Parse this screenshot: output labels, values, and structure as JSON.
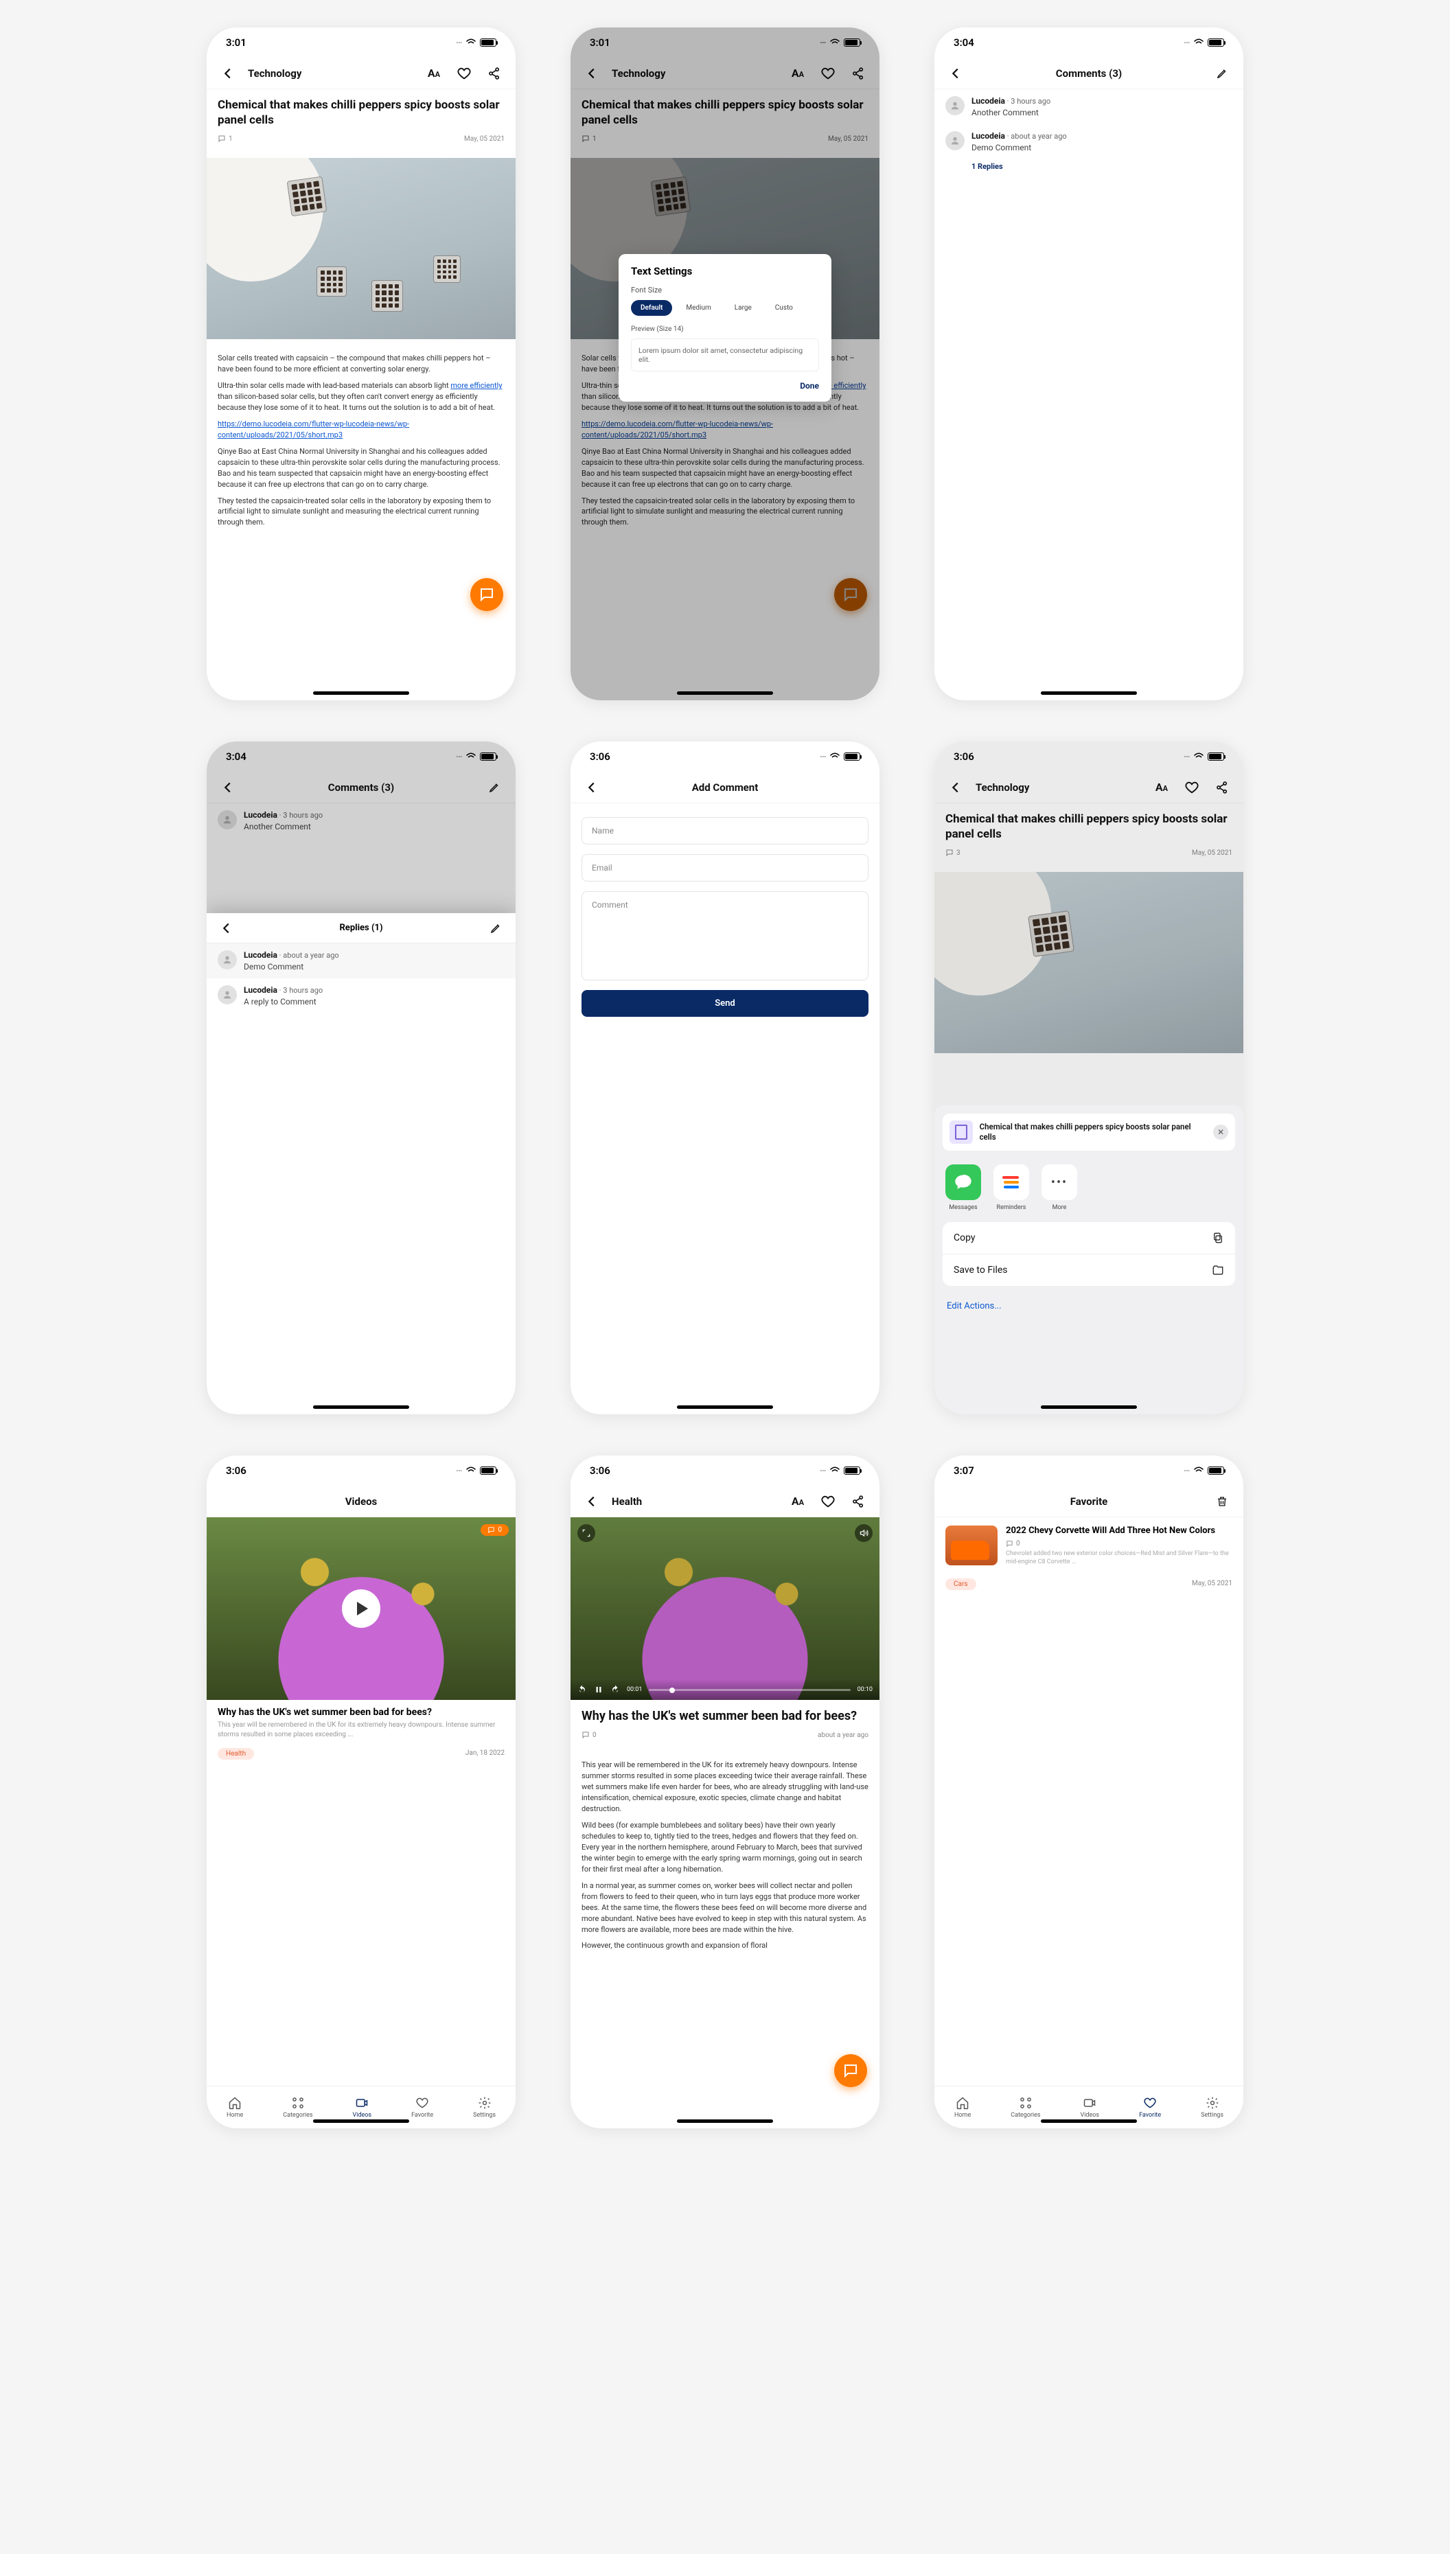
{
  "status": {
    "t1": "3:01",
    "t2": "3:01",
    "t3": "3:04",
    "t4": "3:04",
    "t5": "3:06",
    "t6": "3:06",
    "t7": "3:06",
    "t8": "3:06",
    "t9": "3:07"
  },
  "article": {
    "category": "Technology",
    "title": "Chemical that makes chilli peppers spicy boosts solar panel cells",
    "comments": "1",
    "date": "May, 05 2021",
    "p1": "Solar cells treated with capsaicin – the compound that makes chilli peppers hot – have been found to be more efficient at converting solar energy.",
    "p2a": "Ultra-thin solar cells made with lead-based materials can absorb light ",
    "p2link": "more efficiently",
    "p2b": " than silicon-based solar cells, but they often can't convert energy as efficiently because they lose some of it to heat. It turns out the solution is to add a bit of heat.",
    "link": "https://demo.lucodeia.com/flutter-wp-lucodeia-news/wp-content/uploads/2021/05/short.mp3",
    "p3": "Qinye Bao at East China Normal University in Shanghai and his colleagues added capsaicin to these ultra-thin perovskite solar cells during the manufacturing process. Bao and his team suspected that capsaicin might have an energy-boosting effect because it can free up electrons that can go on to carry charge.",
    "p4": "They tested the capsaicin-treated solar cells in the laboratory by exposing them to artificial light to simulate sunlight and measuring the electrical current running through them."
  },
  "textSettings": {
    "title": "Text Settings",
    "label": "Font Size",
    "opts": [
      "Default",
      "Medium",
      "Large",
      "Custo"
    ],
    "previewLabel": "Preview (Size 14)",
    "previewText": "Lorem ipsum dolor sit amet, consectetur adipiscing elit.",
    "done": "Done"
  },
  "commentsScreen": {
    "title": "Comments (3)",
    "c1": {
      "user": "Lucodeia",
      "time": "3 hours ago",
      "text": "Another Comment"
    },
    "c2": {
      "user": "Lucodeia",
      "time": "about a year ago",
      "text": "Demo Comment"
    },
    "replies": "1 Replies"
  },
  "repliesScreen": {
    "topTitle": "Comments (3)",
    "sheetTitle": "Replies (1)",
    "pinned": {
      "user": "Lucodeia",
      "time": "about a year ago",
      "text": "Demo Comment"
    },
    "r1": {
      "user": "Lucodeia",
      "time": "3 hours ago",
      "text": "A reply to Comment"
    }
  },
  "addComment": {
    "title": "Add Comment",
    "ph_name": "Name",
    "ph_email": "Email",
    "ph_text": "Comment",
    "send": "Send"
  },
  "share": {
    "comments": "3",
    "title": "Chemical that makes chilli peppers spicy boosts solar panel cells",
    "apps": [
      "Messages",
      "Reminders",
      "More"
    ],
    "copy": "Copy",
    "save": "Save to Files",
    "edit": "Edit Actions..."
  },
  "videos": {
    "header": "Videos",
    "title": "Why has the UK's wet summer been bad for bees?",
    "sub": "This year will be remembered in the UK for its extremely heavy downpours. Intense summer storms resulted in some places exceeding ...",
    "tag": "Health",
    "date": "Jan, 18 2022",
    "badge": "0"
  },
  "tabs": {
    "home": "Home",
    "categories": "Categories",
    "videos": "Videos",
    "favorite": "Favorite",
    "settings": "Settings"
  },
  "videoPlay": {
    "header": "Health",
    "time0": "00:01",
    "time1": "00:10",
    "title": "Why has the UK's wet summer been bad for bees?",
    "cm": "0",
    "ago": "about a year ago",
    "p1": "This year will be remembered in the UK for its extremely heavy downpours. Intense summer storms resulted in some places exceeding twice their average rainfall. These wet summers make life even harder for bees, who are already struggling with land-use intensification, chemical exposure, exotic species, climate change and habitat destruction.",
    "p2": "Wild bees (for example bumblebees and solitary bees) have their own yearly schedules to keep to, tightly tied to the trees, hedges and flowers that they feed on. Every year in the northern hemisphere, around February to March, bees that survived the winter begin to emerge with the early spring warm mornings, going out in search for their first meal after a long hibernation.",
    "p3": "In a normal year, as summer comes on, worker bees will collect nectar and pollen from flowers to feed to their queen, who in turn lays eggs that produce more worker bees. At the same time, the flowers these bees feed on will become more diverse and more abundant. Native bees have evolved to keep in step with this natural system. As more flowers are available, more bees are made within the hive.",
    "p4": "However, the continuous growth and expansion of floral"
  },
  "favorite": {
    "header": "Favorite",
    "title": "2022 Chevy Corvette Will Add Three Hot New Colors",
    "cm": "0",
    "desc": "Chevrolet added two new exterior color choices—Red Mist and Silver Flare—to the mid-engine C8 Corvette ...",
    "tag": "Cars",
    "date": "May, 05 2021"
  }
}
